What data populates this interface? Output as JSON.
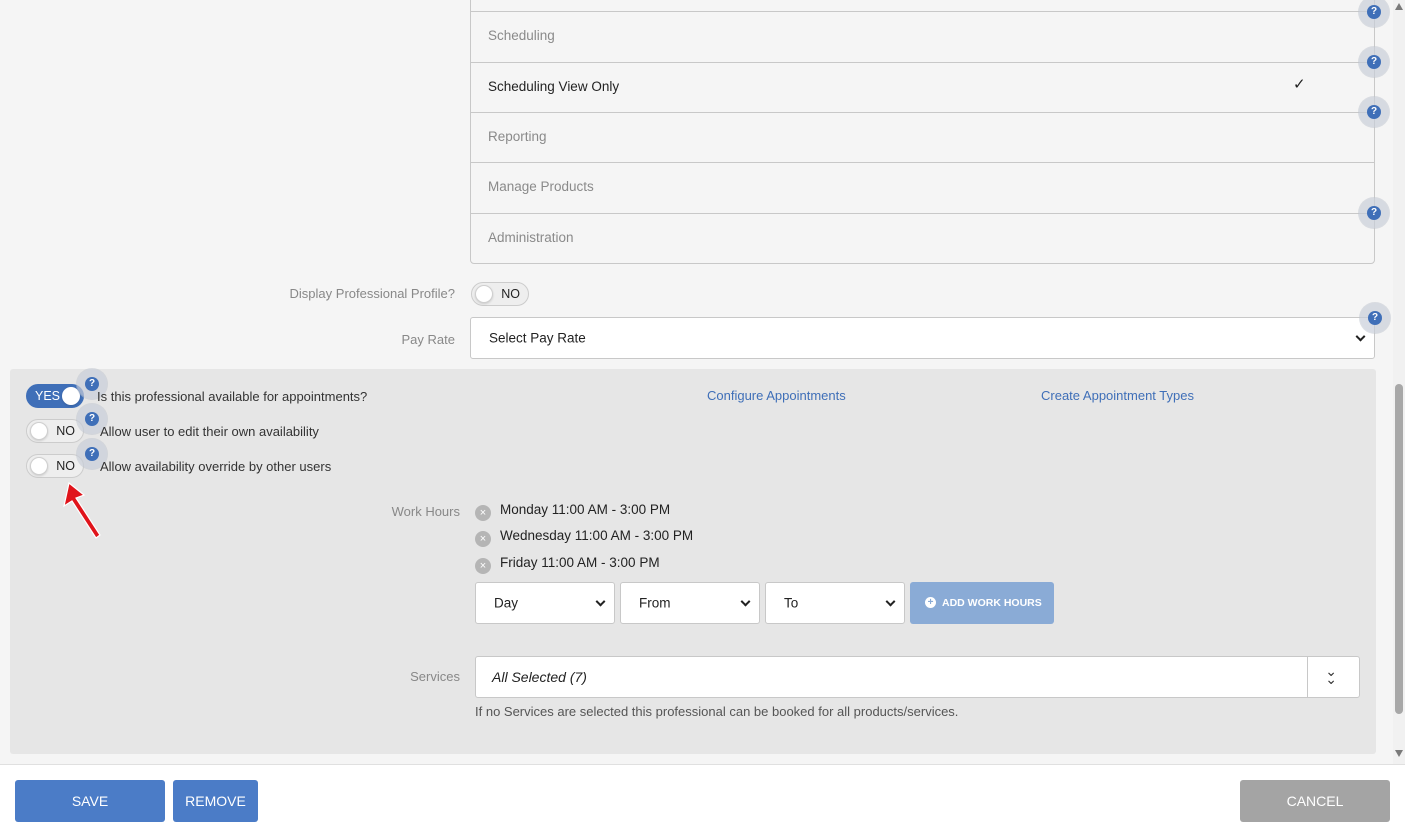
{
  "permissions": {
    "items": [
      {
        "label": "Scheduling",
        "checked": false
      },
      {
        "label": "Scheduling View Only",
        "checked": true
      },
      {
        "label": "Reporting",
        "checked": false
      },
      {
        "label": "Manage Products",
        "checked": false
      },
      {
        "label": "Administration",
        "checked": false
      }
    ],
    "check_mark": "✓"
  },
  "help_icon": "?",
  "profile": {
    "display_label": "Display Professional Profile?",
    "display_value": "NO",
    "pay_rate_label": "Pay Rate",
    "pay_rate_value": "Select Pay Rate"
  },
  "availability": {
    "appointments_toggle": "YES",
    "appointments_label": "Is this professional available for appointments?",
    "edit_toggle": "NO",
    "edit_label": "Allow user to edit their own availability",
    "override_toggle": "NO",
    "override_label": "Allow availability override by other users",
    "configure_link": "Configure Appointments",
    "create_link": "Create Appointment Types"
  },
  "work_hours": {
    "label": "Work Hours",
    "remove_icon": "×",
    "items": [
      "Monday 11:00 AM - 3:00 PM",
      "Wednesday 11:00 AM - 3:00 PM",
      "Friday 11:00 AM - 3:00 PM"
    ],
    "day_select": "Day",
    "from_select": "From",
    "to_select": "To",
    "add_button": "ADD WORK HOURS",
    "add_icon": "+"
  },
  "services": {
    "label": "Services",
    "value": "All Selected (7)",
    "expand_icon": "double-chevron-down-icon",
    "expand_glyph": "⌄",
    "hint": "If no Services are selected this professional can be booked for all products/services."
  },
  "footer": {
    "save": "SAVE",
    "remove": "REMOVE",
    "cancel": "CANCEL"
  },
  "colors": {
    "accent": "#4b7cc7",
    "annotation_arrow": "#e0141b"
  }
}
